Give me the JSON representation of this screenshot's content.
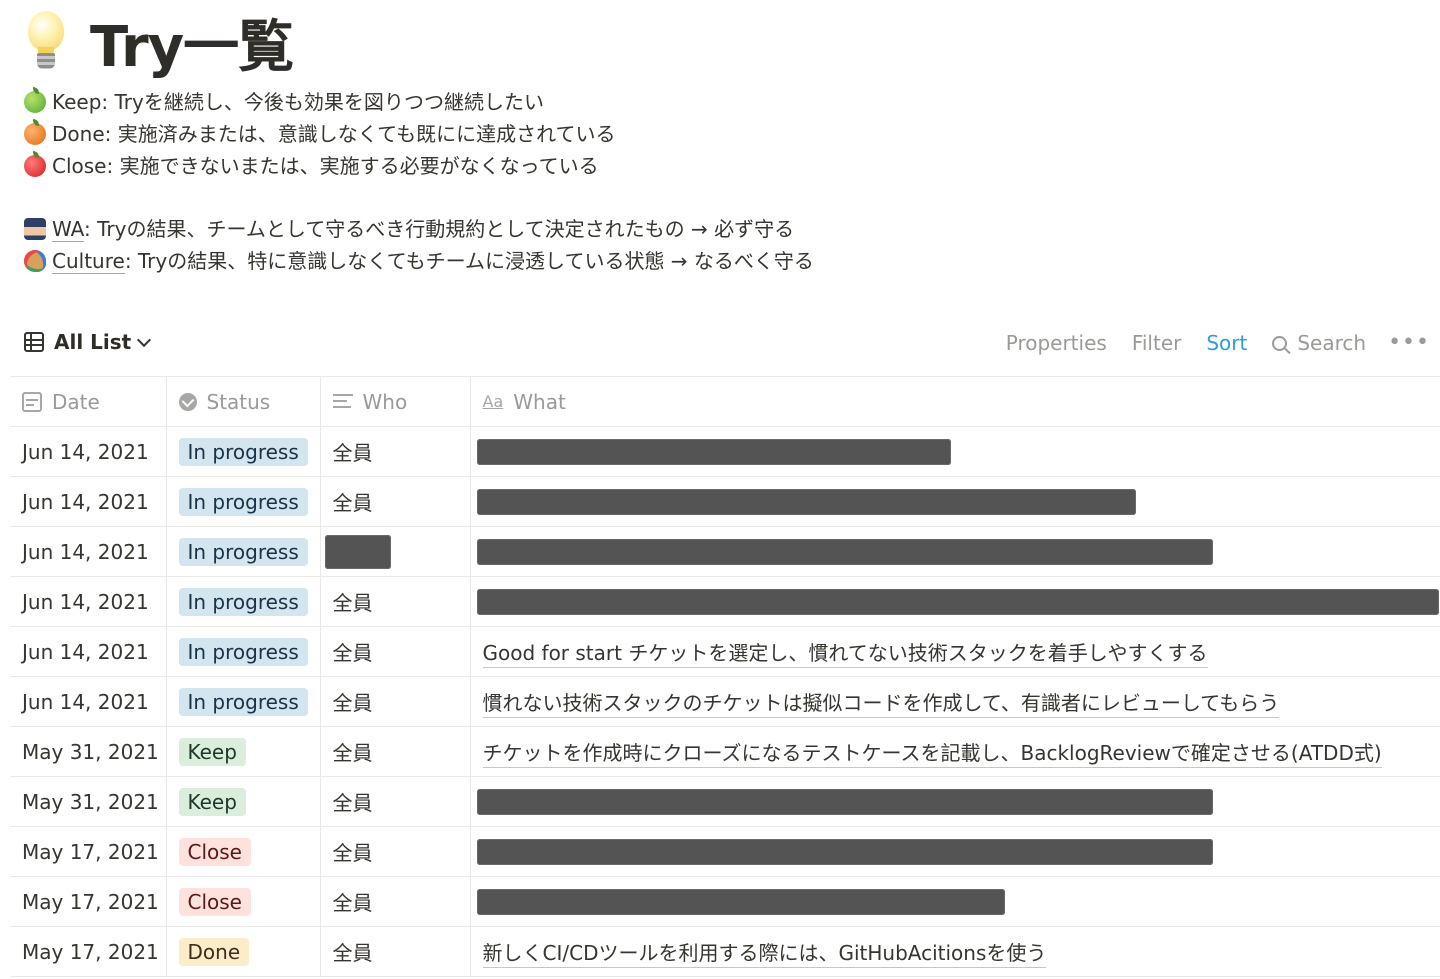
{
  "page": {
    "title": "Try一覧",
    "icon": "lightbulb-icon"
  },
  "legend": [
    {
      "icon": "green-apple-icon",
      "text": "Keep: Tryを継続し、今後も効果を図りつつ継続したい"
    },
    {
      "icon": "tangerine-icon",
      "text": "Done: 実施済みまたは、意識しなくても既にに達成されている"
    },
    {
      "icon": "red-apple-icon",
      "text": "Close: 実施できないまたは、実施する必要がなくなっている"
    }
  ],
  "links": [
    {
      "icon": "police-officer-icon",
      "link": "WA",
      "text": ": Tryの結果、チームとして守るべき行動規約として決定されたもの → 必ず守る"
    },
    {
      "icon": "palette-icon",
      "link": "Culture",
      "text": ": Tryの結果、特に意識しなくてもチームに浸透している状態 → なるべく守る"
    }
  ],
  "view": {
    "name": "All List",
    "actions": {
      "properties": "Properties",
      "filter": "Filter",
      "sort": "Sort",
      "search": "Search"
    },
    "accent_color": "#2e9cdb"
  },
  "columns": [
    {
      "icon": "calendar-icon",
      "label": "Date"
    },
    {
      "icon": "status-icon",
      "label": "Status"
    },
    {
      "icon": "text-lines-icon",
      "label": "Who"
    },
    {
      "icon": "title-aa-icon",
      "label": "What"
    }
  ],
  "status_colors": {
    "In progress": {
      "bg": "#d3e5ef",
      "fg": "#183347"
    },
    "Keep": {
      "bg": "#dbeddb",
      "fg": "#1c3829"
    },
    "Close": {
      "bg": "#ffe2dd",
      "fg": "#5d1715"
    },
    "Done": {
      "bg": "#fdecc8",
      "fg": "#402c1b"
    }
  },
  "rows": [
    {
      "date": "Jun 14, 2021",
      "status": "In progress",
      "who": "全員",
      "what": ""
    },
    {
      "date": "Jun 14, 2021",
      "status": "In progress",
      "who": "全員",
      "what": ""
    },
    {
      "date": "Jun 14, 2021",
      "status": "In progress",
      "who": "",
      "what": ""
    },
    {
      "date": "Jun 14, 2021",
      "status": "In progress",
      "who": "全員",
      "what": ""
    },
    {
      "date": "Jun 14, 2021",
      "status": "In progress",
      "who": "全員",
      "what": "Good for start チケットを選定し、慣れてない技術スタックを着手しやすくする"
    },
    {
      "date": "Jun 14, 2021",
      "status": "In progress",
      "who": "全員",
      "what": "慣れない技術スタックのチケットは擬似コードを作成して、有識者にレビューしてもらう"
    },
    {
      "date": "May 31, 2021",
      "status": "Keep",
      "who": "全員",
      "what": "チケットを作成時にクローズになるテストケースを記載し、BacklogReviewで確定させる(ATDD式)"
    },
    {
      "date": "May 31, 2021",
      "status": "Keep",
      "who": "全員",
      "what": ""
    },
    {
      "date": "May 17, 2021",
      "status": "Close",
      "who": "全員",
      "what": ""
    },
    {
      "date": "May 17, 2021",
      "status": "Close",
      "who": "全員",
      "what": ""
    },
    {
      "date": "May 17, 2021",
      "status": "Done",
      "who": "全員",
      "what": "新しくCI/CDツールを利用する際には、GitHubAcitionsを使う"
    }
  ]
}
